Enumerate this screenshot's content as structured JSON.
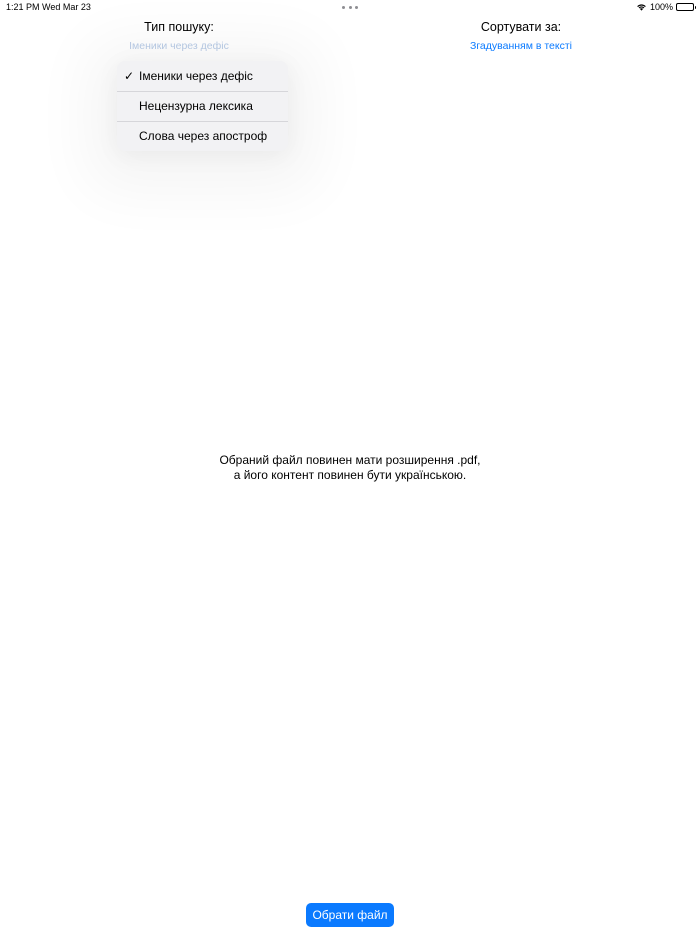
{
  "status_bar": {
    "time": "1:21 PM",
    "date": "Wed Mar 23",
    "battery": "100%"
  },
  "search_type": {
    "label": "Тип пошуку:",
    "value": "Іменики через дефіс"
  },
  "sort": {
    "label": "Сортувати за:",
    "value": "Згадуванням в тексті"
  },
  "menu": {
    "check_glyph": "✓",
    "items": [
      {
        "label": "Іменики через дефіс",
        "selected": true
      },
      {
        "label": "Нецензурна лексика",
        "selected": false
      },
      {
        "label": "Слова через апостроф",
        "selected": false
      }
    ]
  },
  "info": {
    "line1": "Обраний файл повинен мати розширення .pdf,",
    "line2": "а його контент повинен бути українською."
  },
  "actions": {
    "choose_file_label": "Обрати файл"
  },
  "colors": {
    "accent": "#0a7aff",
    "placeholder_value": "#b8cbe6",
    "menu_background": "#f2f2f4"
  }
}
